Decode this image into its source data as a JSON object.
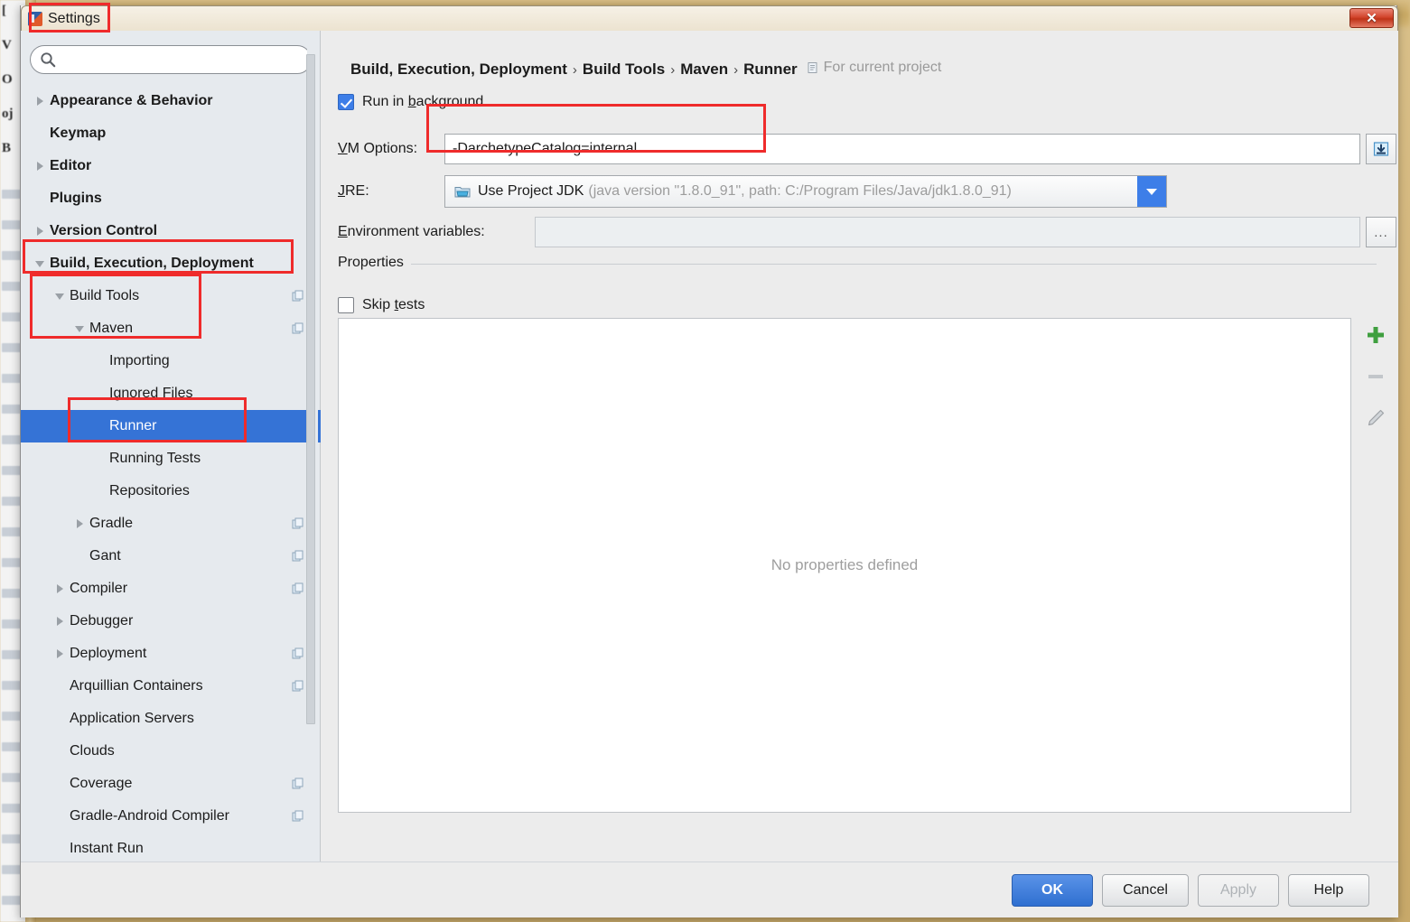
{
  "window": {
    "title": "Settings",
    "app_icon": "intellij-idea-icon",
    "close_label": "✕"
  },
  "search": {
    "value": "",
    "placeholder": "",
    "icon": "search-icon"
  },
  "sidebar": {
    "items": [
      {
        "label": "Appearance & Behavior",
        "indent": 0,
        "arrow": "collapsed",
        "bold": true,
        "scope_icon": false,
        "selected": false
      },
      {
        "label": "Keymap",
        "indent": 0,
        "arrow": "none",
        "bold": true,
        "scope_icon": false,
        "selected": false
      },
      {
        "label": "Editor",
        "indent": 0,
        "arrow": "collapsed",
        "bold": true,
        "scope_icon": false,
        "selected": false
      },
      {
        "label": "Plugins",
        "indent": 0,
        "arrow": "none",
        "bold": true,
        "scope_icon": false,
        "selected": false
      },
      {
        "label": "Version Control",
        "indent": 0,
        "arrow": "collapsed",
        "bold": true,
        "scope_icon": false,
        "selected": false
      },
      {
        "label": "Build, Execution, Deployment",
        "indent": 0,
        "arrow": "expanded",
        "bold": true,
        "scope_icon": false,
        "selected": false
      },
      {
        "label": "Build Tools",
        "indent": 1,
        "arrow": "expanded",
        "bold": false,
        "scope_icon": true,
        "selected": false
      },
      {
        "label": "Maven",
        "indent": 2,
        "arrow": "expanded",
        "bold": false,
        "scope_icon": true,
        "selected": false
      },
      {
        "label": "Importing",
        "indent": 3,
        "arrow": "none",
        "bold": false,
        "scope_icon": false,
        "selected": false
      },
      {
        "label": "Ignored Files",
        "indent": 3,
        "arrow": "none",
        "bold": false,
        "scope_icon": false,
        "selected": false
      },
      {
        "label": "Runner",
        "indent": 3,
        "arrow": "none",
        "bold": false,
        "scope_icon": false,
        "selected": true
      },
      {
        "label": "Running Tests",
        "indent": 3,
        "arrow": "none",
        "bold": false,
        "scope_icon": false,
        "selected": false
      },
      {
        "label": "Repositories",
        "indent": 3,
        "arrow": "none",
        "bold": false,
        "scope_icon": false,
        "selected": false
      },
      {
        "label": "Gradle",
        "indent": 2,
        "arrow": "collapsed",
        "bold": false,
        "scope_icon": true,
        "selected": false
      },
      {
        "label": "Gant",
        "indent": 2,
        "arrow": "none",
        "bold": false,
        "scope_icon": true,
        "selected": false
      },
      {
        "label": "Compiler",
        "indent": 1,
        "arrow": "collapsed",
        "bold": false,
        "scope_icon": true,
        "selected": false
      },
      {
        "label": "Debugger",
        "indent": 1,
        "arrow": "collapsed",
        "bold": false,
        "scope_icon": false,
        "selected": false
      },
      {
        "label": "Deployment",
        "indent": 1,
        "arrow": "collapsed",
        "bold": false,
        "scope_icon": true,
        "selected": false
      },
      {
        "label": "Arquillian Containers",
        "indent": 1,
        "arrow": "none",
        "bold": false,
        "scope_icon": true,
        "selected": false
      },
      {
        "label": "Application Servers",
        "indent": 1,
        "arrow": "none",
        "bold": false,
        "scope_icon": false,
        "selected": false
      },
      {
        "label": "Clouds",
        "indent": 1,
        "arrow": "none",
        "bold": false,
        "scope_icon": false,
        "selected": false
      },
      {
        "label": "Coverage",
        "indent": 1,
        "arrow": "none",
        "bold": false,
        "scope_icon": true,
        "selected": false
      },
      {
        "label": "Gradle-Android Compiler",
        "indent": 1,
        "arrow": "none",
        "bold": false,
        "scope_icon": true,
        "selected": false
      },
      {
        "label": "Instant Run",
        "indent": 1,
        "arrow": "none",
        "bold": false,
        "scope_icon": false,
        "selected": false
      }
    ]
  },
  "breadcrumb": {
    "parts": [
      "Build, Execution, Deployment",
      "Build Tools",
      "Maven",
      "Runner"
    ],
    "separator": "›",
    "scope_note": "For current project",
    "scope_icon": "project-scope-icon"
  },
  "form": {
    "run_in_background": {
      "label": "Run in background",
      "checked": true,
      "mnemonic": "b"
    },
    "vm_options": {
      "label": "VM Options:",
      "mnemonic": "V",
      "value": "-DarchetypeCatalog=internal",
      "expand_button_icon": "insert-macro-icon"
    },
    "jre": {
      "label": "JRE:",
      "mnemonic": "J",
      "value": "Use Project JDK",
      "detail": "(java version \"1.8.0_91\", path: C:/Program Files/Java/jdk1.8.0_91)",
      "icon": "jdk-folder-icon",
      "dropdown_icon": "chevron-down-icon"
    },
    "environment_variables": {
      "label": "Environment variables:",
      "mnemonic": "E",
      "value": "",
      "browse_label": "..."
    }
  },
  "properties": {
    "group_title": "Properties",
    "skip_tests": {
      "label": "Skip tests",
      "checked": false,
      "mnemonic": "t"
    },
    "empty_message": "No properties defined",
    "toolbar": [
      {
        "name": "add-property-button",
        "icon": "plus-icon",
        "enabled": true
      },
      {
        "name": "remove-property-button",
        "icon": "minus-icon",
        "enabled": false
      },
      {
        "name": "edit-property-button",
        "icon": "pencil-icon",
        "enabled": false
      }
    ]
  },
  "buttons": {
    "ok": "OK",
    "cancel": "Cancel",
    "apply": "Apply",
    "help": "Help",
    "apply_enabled": false
  },
  "colors": {
    "selection_blue": "#3573d6",
    "primary_button": "#2f6fd0",
    "annotation_red": "#ef2b2b",
    "checkbox_blue": "#3d7ee8",
    "muted_text": "#9e9e9e"
  }
}
